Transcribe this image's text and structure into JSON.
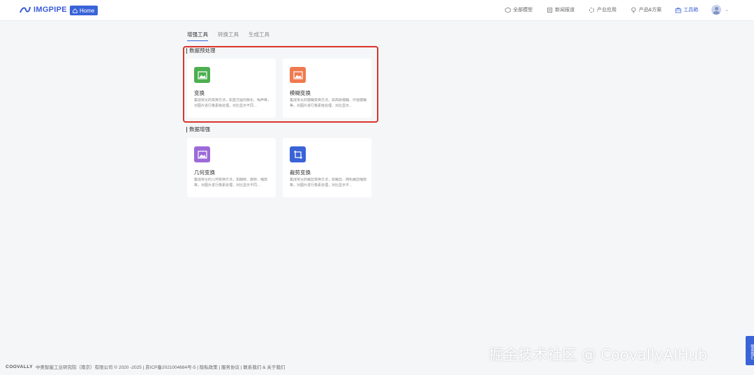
{
  "header": {
    "logo_text": "IMGPIPE",
    "home_label": "Home",
    "nav": [
      {
        "label": "全部模型",
        "icon": "cube-icon"
      },
      {
        "label": "新闻报道",
        "icon": "newspaper-icon"
      },
      {
        "label": "产业应用",
        "icon": "puzzle-icon"
      },
      {
        "label": "产品&方案",
        "icon": "lightbulb-icon"
      },
      {
        "label": "工具箱",
        "icon": "toolbox-icon",
        "active": true
      }
    ],
    "caret": "⌄"
  },
  "tabs": [
    {
      "label": "增强工具",
      "active": true
    },
    {
      "label": "转换工具"
    },
    {
      "label": "生成工具"
    }
  ],
  "sections": [
    {
      "title": "数据预处理",
      "cards": [
        {
          "title": "变换",
          "desc": "集成常见的变换方法，如直方图均衡化、噪声等，对图片进行像素级处理，对比显示不同…",
          "color": "#4caf50"
        },
        {
          "title": "模糊变换",
          "desc": "集成常见的模糊变换方法，如高斯模糊、中值模糊等，对图片进行像素级处理，对比显示…",
          "color": "#f07a4f"
        }
      ]
    },
    {
      "title": "数据增强",
      "cards": [
        {
          "title": "几何变换",
          "desc": "集成常见的几何变换方法，如翻转、旋转、缩放等，对图片进行像素处理，对比显示不同…",
          "color": "#9c6ad8"
        },
        {
          "title": "裁剪变换",
          "desc": "集成常见的裁剪变换方法，如裁剪、随机裁剪缩放等，对图片进行像素处理，对比显示不…",
          "color": "#3a63d8"
        }
      ]
    }
  ],
  "footer": {
    "logo": "COOVALLY",
    "text": "中奥智能工业研究院（南京）有限公司 © 2020 -2025 | 苏ICP备2021004684号-5 | 隐私政策 | 服务协议 | 联系我们 & 关于我们"
  },
  "watermark": "掘金技术社区 @ CoovallyAIHub",
  "side_float": "联系我们"
}
